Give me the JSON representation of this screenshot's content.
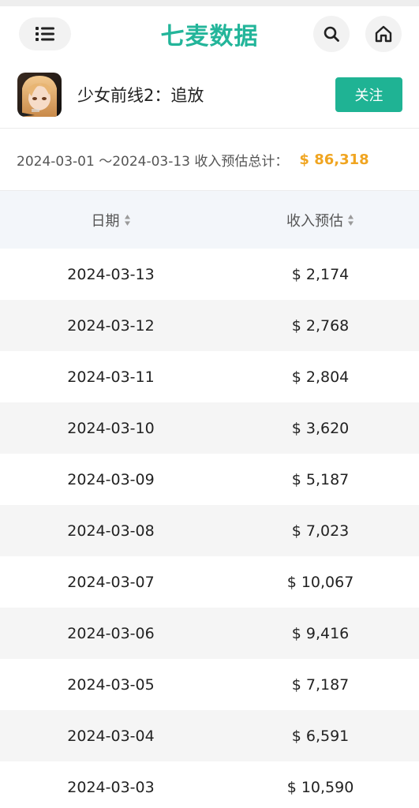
{
  "header": {
    "brand": "七麦数据",
    "menu_icon": "list-icon",
    "search_icon": "search-icon",
    "home_icon": "home-icon",
    "accent_color": "#23b59a"
  },
  "app": {
    "name": "少女前线2：追放",
    "follow_label": "关注",
    "follow_color": "#1fb394"
  },
  "summary": {
    "range": "2024-03-01 ～2024-03-13 收入预估总计：",
    "total": "$ 86,318",
    "total_color": "#f0a521"
  },
  "table": {
    "columns": [
      "日期",
      "收入预估"
    ],
    "rows": [
      {
        "date": "2024-03-13",
        "revenue": "$ 2,174"
      },
      {
        "date": "2024-03-12",
        "revenue": "$ 2,768"
      },
      {
        "date": "2024-03-11",
        "revenue": "$ 2,804"
      },
      {
        "date": "2024-03-10",
        "revenue": "$ 3,620"
      },
      {
        "date": "2024-03-09",
        "revenue": "$ 5,187"
      },
      {
        "date": "2024-03-08",
        "revenue": "$ 7,023"
      },
      {
        "date": "2024-03-07",
        "revenue": "$ 10,067"
      },
      {
        "date": "2024-03-06",
        "revenue": "$ 9,416"
      },
      {
        "date": "2024-03-05",
        "revenue": "$ 7,187"
      },
      {
        "date": "2024-03-04",
        "revenue": "$ 6,591"
      },
      {
        "date": "2024-03-03",
        "revenue": "$ 10,590"
      }
    ]
  }
}
